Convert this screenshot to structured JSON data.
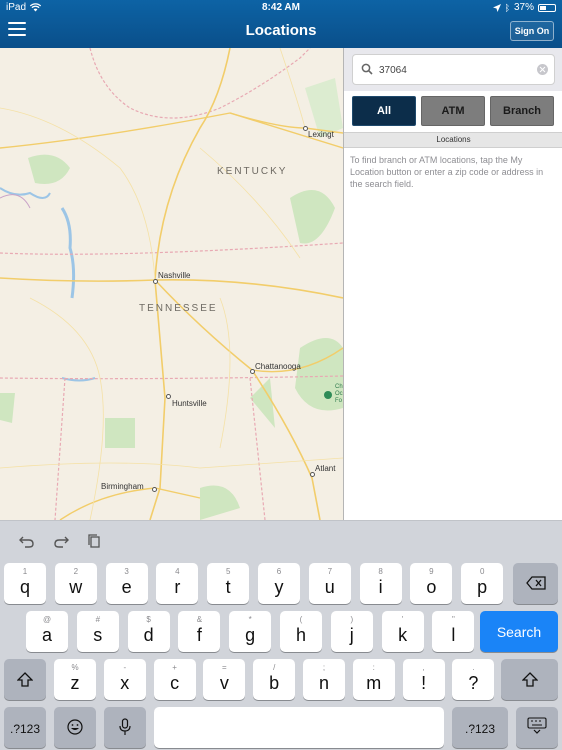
{
  "status_bar": {
    "carrier": "iPad",
    "time": "8:42 AM",
    "battery": "37%"
  },
  "nav": {
    "title": "Locations",
    "sign_in_label": "Sign On"
  },
  "map": {
    "labels": {
      "kentucky": "KENTUCKY",
      "tennessee": "TENNESSEE",
      "nashville": "Nashville",
      "lexington": "Lexingt",
      "chattanooga": "Chattanooga",
      "huntsville": "Huntsville",
      "birmingham": "Birmingham",
      "atlanta": "Atlant",
      "park_fragment": "Ch Oc Fo"
    }
  },
  "panel": {
    "search": {
      "value": "37064",
      "placeholder": ""
    },
    "filters": [
      "All",
      "ATM",
      "Branch"
    ],
    "selected_filter": "All",
    "section_header": "Locations",
    "info_text": "To find branch or ATM locations, tap the My Location button or enter a zip code or address in the search field."
  },
  "keyboard": {
    "row1": [
      {
        "main": "q",
        "alt": "1"
      },
      {
        "main": "w",
        "alt": "2"
      },
      {
        "main": "e",
        "alt": "3"
      },
      {
        "main": "r",
        "alt": "4"
      },
      {
        "main": "t",
        "alt": "5"
      },
      {
        "main": "y",
        "alt": "6"
      },
      {
        "main": "u",
        "alt": "7"
      },
      {
        "main": "i",
        "alt": "8"
      },
      {
        "main": "o",
        "alt": "9"
      },
      {
        "main": "p",
        "alt": "0"
      }
    ],
    "row2": [
      {
        "main": "a",
        "alt": "@"
      },
      {
        "main": "s",
        "alt": "#"
      },
      {
        "main": "d",
        "alt": "$"
      },
      {
        "main": "f",
        "alt": "&"
      },
      {
        "main": "g",
        "alt": "*"
      },
      {
        "main": "h",
        "alt": "("
      },
      {
        "main": "j",
        "alt": ")"
      },
      {
        "main": "k",
        "alt": "'"
      },
      {
        "main": "l",
        "alt": "\""
      }
    ],
    "row3": [
      {
        "main": "z",
        "alt": "%"
      },
      {
        "main": "x",
        "alt": "-"
      },
      {
        "main": "c",
        "alt": "+"
      },
      {
        "main": "v",
        "alt": "="
      },
      {
        "main": "b",
        "alt": "/"
      },
      {
        "main": "n",
        "alt": ";"
      },
      {
        "main": "m",
        "alt": ":"
      },
      {
        "main": "!",
        "alt": ","
      },
      {
        "main": "?",
        "alt": "."
      }
    ],
    "search_label": "Search",
    "numbers_label": ".?123"
  }
}
